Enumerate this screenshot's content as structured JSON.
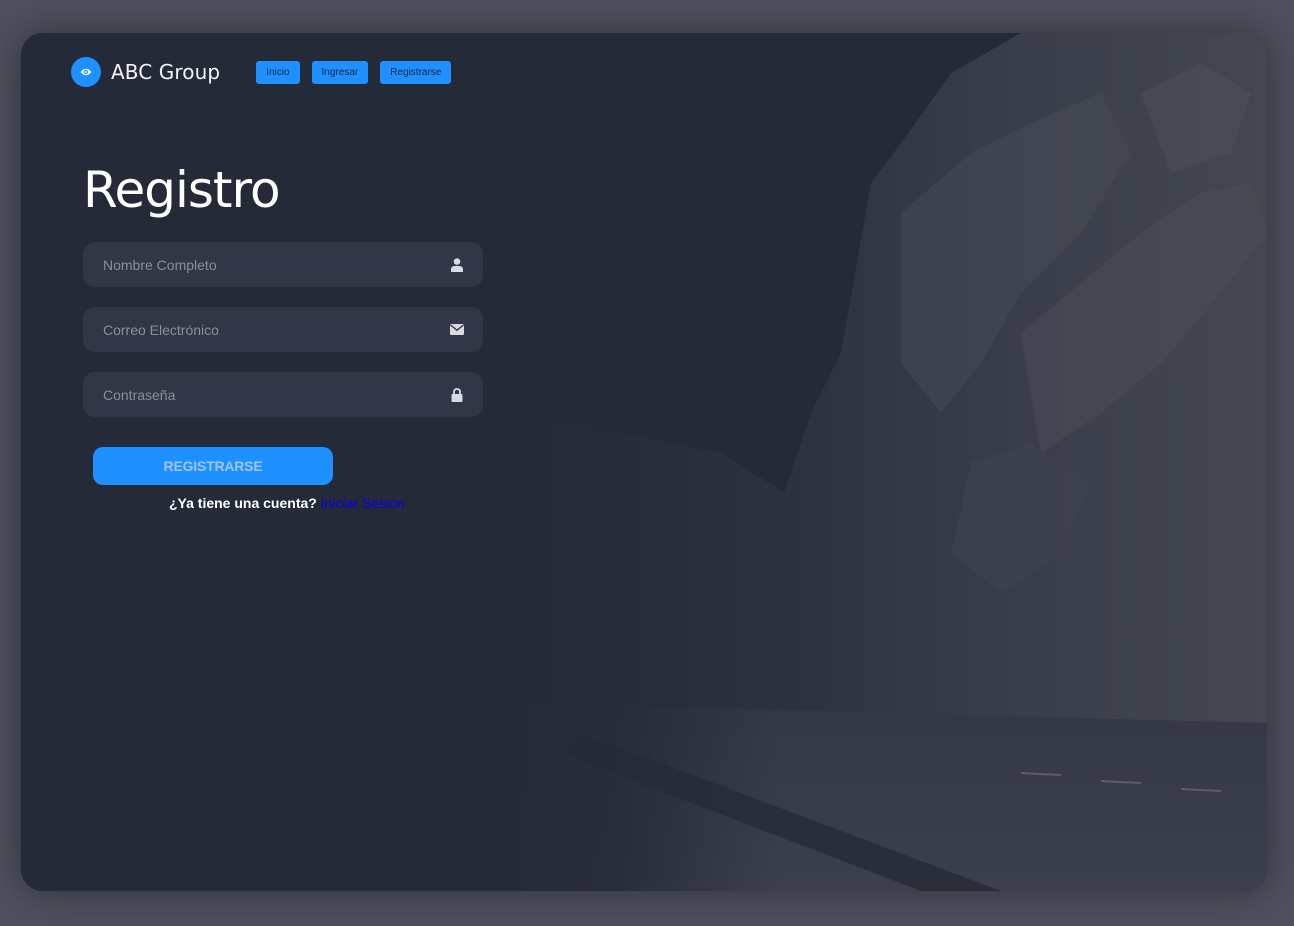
{
  "brand": {
    "name": "ABC Group",
    "logo_icon": "eye-icon"
  },
  "nav": {
    "items": [
      {
        "label": "Inicio"
      },
      {
        "label": "Ingresar"
      },
      {
        "label": "Registrarse"
      }
    ]
  },
  "form": {
    "title": "Registro",
    "fields": [
      {
        "placeholder": "Nombre Completo",
        "value": "",
        "icon": "user-icon"
      },
      {
        "placeholder": "Correo Electrónico",
        "value": "",
        "icon": "envelope-icon"
      },
      {
        "placeholder": "Contraseña",
        "value": "",
        "icon": "lock-icon"
      }
    ],
    "submit_label": "REGISTRARSE",
    "login_prompt": "¿Ya tiene una cuenta?",
    "login_link": "Iniciar Sesion"
  },
  "colors": {
    "accent": "#1e90ff",
    "page_background": "#4f515f",
    "card_background": "#252a38",
    "field_background": "#323748",
    "link": "#0000ee"
  }
}
